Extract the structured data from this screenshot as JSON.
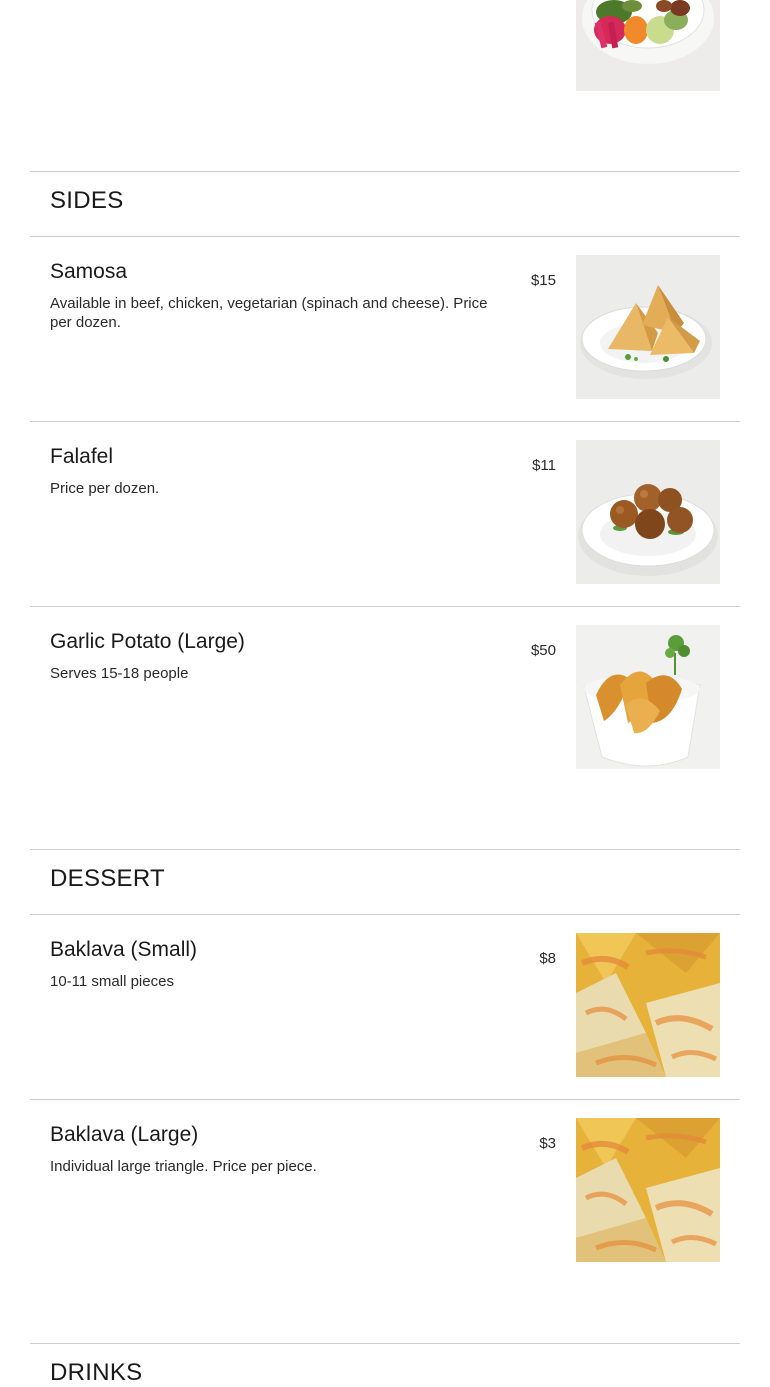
{
  "sections": {
    "sides": {
      "title": "SIDES",
      "items": [
        {
          "name": "Samosa",
          "description": "Available in beef, chicken, vegetarian (spinach and cheese). Price per dozen.",
          "price": "$15",
          "image": "samosa-photo"
        },
        {
          "name": "Falafel",
          "description": "Price per dozen.",
          "price": "$11",
          "image": "falafel-photo"
        },
        {
          "name": "Garlic Potato (Large)",
          "description": "Serves 15-18 people",
          "price": "$50",
          "image": "garlic-potato-photo"
        }
      ]
    },
    "dessert": {
      "title": "DESSERT",
      "items": [
        {
          "name": "Baklava (Small)",
          "description": "10-11 small pieces",
          "price": "$8",
          "image": "baklava-photo"
        },
        {
          "name": "Baklava (Large)",
          "description": "Individual large triangle. Price per piece.",
          "price": "$3",
          "image": "baklava-photo"
        }
      ]
    },
    "drinks": {
      "title": "DRINKS"
    }
  },
  "top_image": "salad-plate-photo",
  "colors": {
    "divider": "#cfcfcf",
    "text": "#1a1a1a",
    "baklava_gold": "#e6b23a",
    "baklava_drizzle": "#e58b3a"
  }
}
